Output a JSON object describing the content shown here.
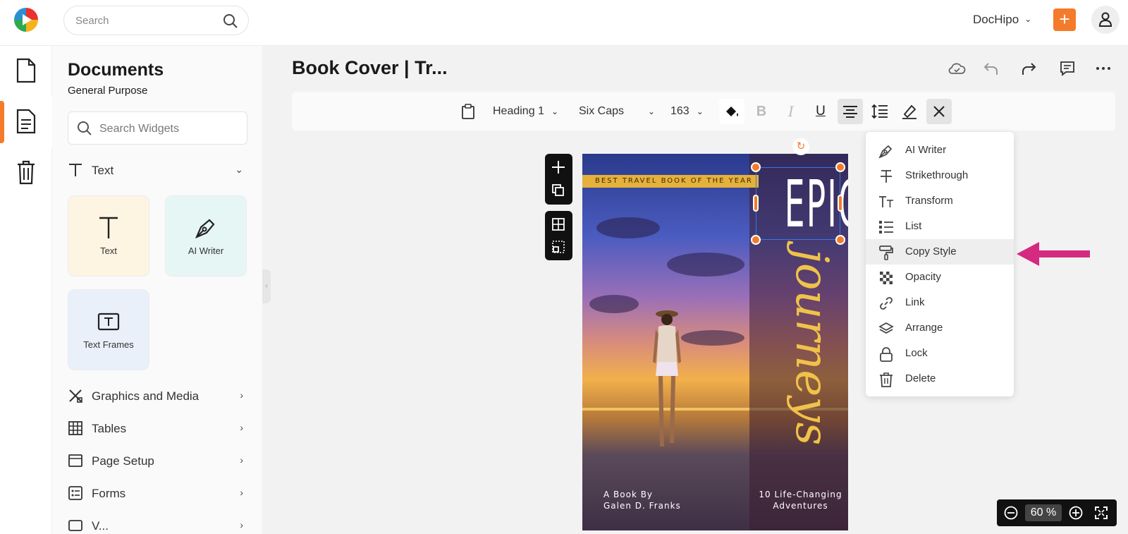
{
  "header": {
    "search_placeholder": "Search",
    "workspace": "DocHipo",
    "add_label": "+"
  },
  "panel": {
    "title": "Documents",
    "subtitle": "General Purpose",
    "search_placeholder": "Search Widgets",
    "text_section": "Text",
    "tiles": [
      {
        "label": "Text"
      },
      {
        "label": "AI Writer"
      },
      {
        "label": "Text Frames"
      }
    ],
    "sections": [
      {
        "label": "Graphics and Media"
      },
      {
        "label": "Tables"
      },
      {
        "label": "Page Setup"
      },
      {
        "label": "Forms"
      },
      {
        "label": "V..."
      }
    ]
  },
  "document": {
    "title": "Book Cover | Tr..."
  },
  "toolbar": {
    "style": "Heading 1",
    "font": "Six Caps",
    "size": "163"
  },
  "cover": {
    "ribbon": "BEST TRAVEL BOOK OF THE YEAR",
    "headline": "EPIC",
    "script": "journeys",
    "author_line1": "A Book By",
    "author_line2": "Galen D. Franks",
    "subtitle_line1": "10 Life-Changing",
    "subtitle_line2": "Adventures"
  },
  "context_menu": {
    "items": [
      {
        "label": "AI Writer",
        "icon": "pen-nib-icon"
      },
      {
        "label": "Strikethrough",
        "icon": "strikethrough-icon"
      },
      {
        "label": "Transform",
        "icon": "text-case-icon"
      },
      {
        "label": "List",
        "icon": "list-icon"
      },
      {
        "label": "Copy Style",
        "icon": "paint-roller-icon",
        "highlighted": true
      },
      {
        "label": "Opacity",
        "icon": "checkerboard-icon"
      },
      {
        "label": "Link",
        "icon": "link-icon"
      },
      {
        "label": "Arrange",
        "icon": "layers-icon"
      },
      {
        "label": "Lock",
        "icon": "lock-icon"
      },
      {
        "label": "Delete",
        "icon": "trash-icon"
      }
    ]
  },
  "zoom": {
    "value": "60",
    "unit": "%"
  },
  "colors": {
    "accent": "#f47b2a",
    "pointer": "#d42a7f",
    "selection": "#2c7be5",
    "script": "#f0c24a"
  }
}
